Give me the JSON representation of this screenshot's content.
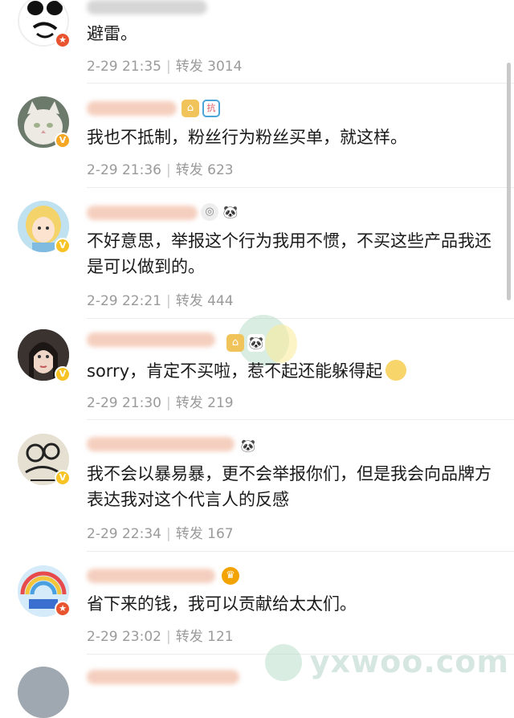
{
  "comments": [
    {
      "text": "避雷。",
      "date": "2-29 21:35",
      "repost_label": "转发",
      "repost_count": "3014",
      "avatar": "panda-avatar",
      "badge": "orange-star",
      "icons": []
    },
    {
      "text": "我也不抵制，粉丝行为粉丝买单，就这样。",
      "date": "2-29 21:36",
      "repost_label": "转发",
      "repost_count": "623",
      "avatar": "cat-avatar",
      "badge": "orange-v",
      "icons": [
        "house-icon",
        "shield-icon"
      ],
      "icon_glyphs": [
        "⌂",
        "抗"
      ]
    },
    {
      "text": "不好意思，举报这个行为我用不惯，不买这些产品我还是可以做到的。",
      "date": "2-29 22:21",
      "repost_label": "转发",
      "repost_count": "444",
      "avatar": "cartoon-girl-avatar",
      "badge": "yellow-v",
      "icons": [
        "medal-icon",
        "panda-icon"
      ],
      "icon_glyphs": [
        "◎",
        "🐼"
      ]
    },
    {
      "text": "sorry，肯定不买啦，惹不起还能躲得起",
      "date": "2-29 21:30",
      "repost_label": "转发",
      "repost_count": "219",
      "avatar": "woman-avatar",
      "badge": "yellow-v",
      "icons": [
        "house-icon",
        "panda-icon"
      ],
      "icon_glyphs": [
        "⌂",
        "🐼"
      ]
    },
    {
      "text": "我不会以暴易暴，更不会举报你们，但是我会向品牌方表达我对这个代言人的反感",
      "date": "2-29 22:34",
      "repost_label": "转发",
      "repost_count": "167",
      "avatar": "sketch-avatar",
      "badge": "yellow-v",
      "icons": [
        "panda-icon"
      ],
      "icon_glyphs": [
        "🐼"
      ]
    },
    {
      "text": "省下来的钱，我可以贡献给太太们。",
      "date": "2-29 23:02",
      "repost_label": "转发",
      "repost_count": "121",
      "avatar": "rainbow-avatar",
      "badge": "red-star",
      "icons": [
        "crown-icon"
      ],
      "icon_glyphs": [
        "♛"
      ]
    }
  ],
  "watermark": "yxwoo.com",
  "colors": {
    "meta_gray": "#9a9a9a",
    "badge_orange": "#f5a623",
    "badge_yellow": "#f7c325",
    "badge_red": "#e8542f"
  }
}
